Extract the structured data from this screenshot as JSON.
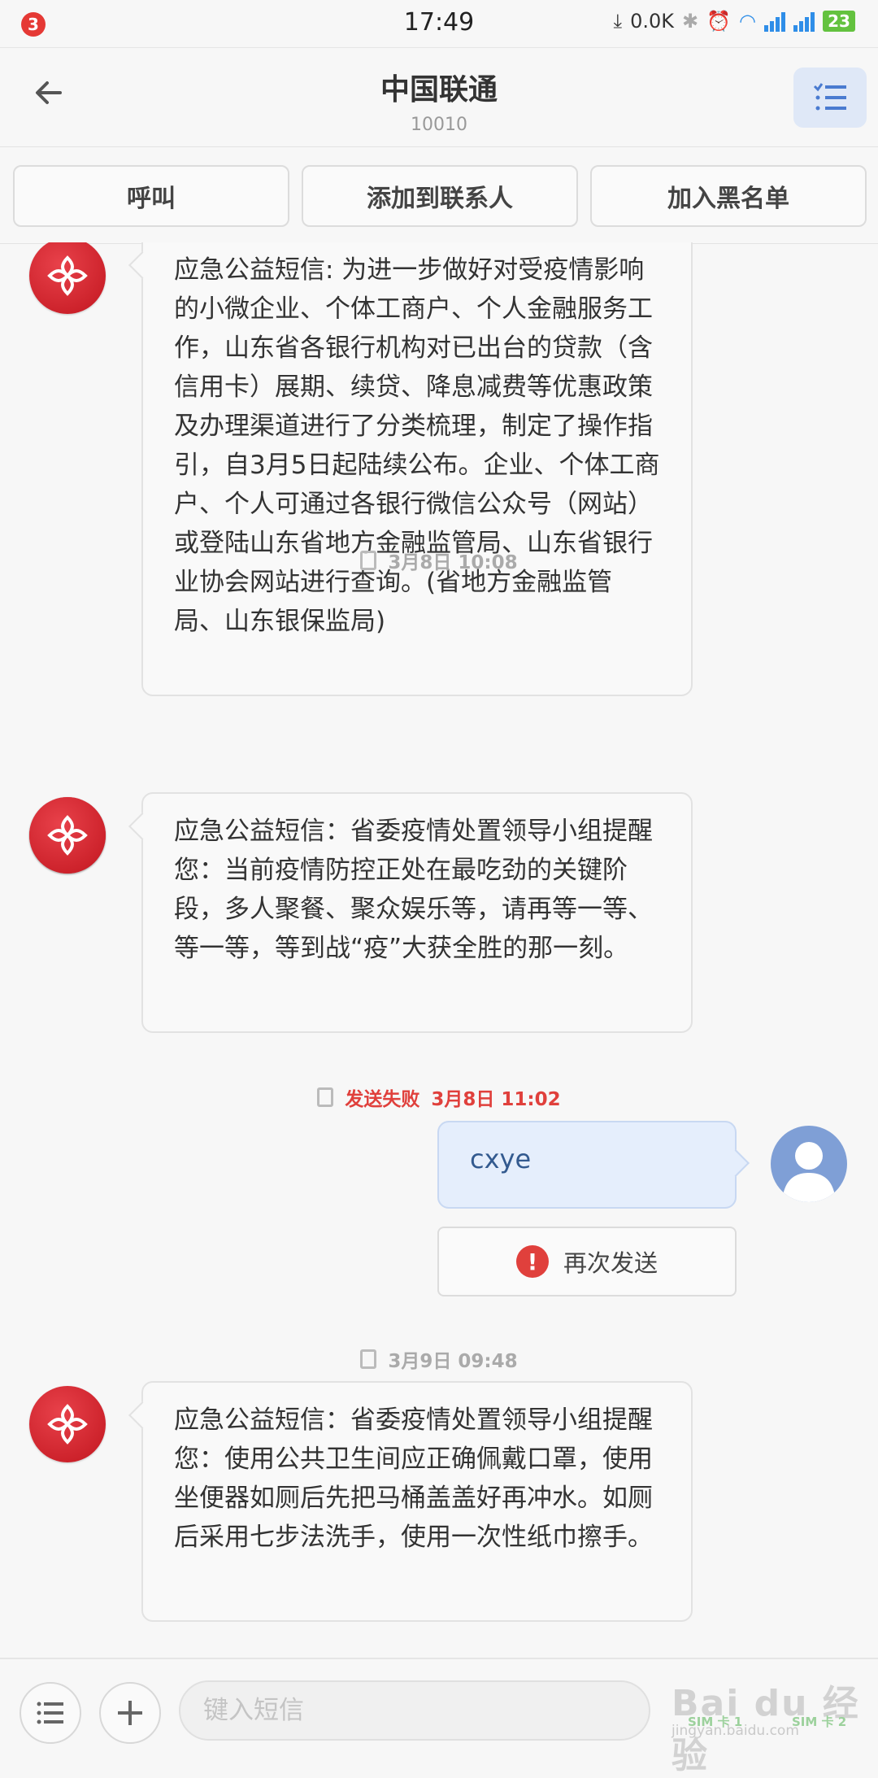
{
  "status_bar": {
    "notification_count": "3",
    "time": "17:49",
    "net_speed": "0.0K",
    "battery": "23"
  },
  "header": {
    "title": "中国联通",
    "subtitle": "10010"
  },
  "actions": {
    "call": "呼叫",
    "add_contact": "添加到联系人",
    "blacklist": "加入黑名单"
  },
  "messages": {
    "m1_text": "应急公益短信: 为进一步做好对受疫情影响的小微企业、个体工商户、个人金融服务工作，山东省各银行机构对已出台的贷款（含信用卡）展期、续贷、降息减费等优惠政策及办理渠道进行了分类梳理，制定了操作指引，自3月5日起陆续公布。企业、个体工商户、个人可通过各银行微信公众号（网站）或登陆山东省地方金融监管局、山东省银行业协会网站进行查询。(省地方金融监管局、山东银保监局)",
    "ts2": "3月8日 10:08",
    "m2_text": "应急公益短信：省委疫情处置领导小组提醒您：当前疫情防控正处在最吃劲的关键阶段，多人聚餐、聚众娱乐等，请再等一等、等一等，等到战“疫”大获全胜的那一刻。",
    "fail_label": "发送失败",
    "ts3": "3月8日 11:02",
    "out_text": "cxye",
    "resend_label": "再次发送",
    "ts4": "3月9日 09:48",
    "m4_text": "应急公益短信：省委疫情处置领导小组提醒您：使用公共卫生间应正确佩戴口罩，使用坐便器如厕后先把马桶盖盖好再冲水。如厕后采用七步法洗手，使用一次性纸巾擦手。"
  },
  "input": {
    "placeholder": "键入短信",
    "sim1": "SIM 卡 1",
    "sim2": "SIM 卡 2"
  },
  "watermark": {
    "main": "Bai du 经验",
    "sub": "jingyan.baidu.com"
  },
  "colors": {
    "accent_red": "#e0403c",
    "unicom_red": "#c2161f",
    "out_bubble": "#e5eefc"
  }
}
